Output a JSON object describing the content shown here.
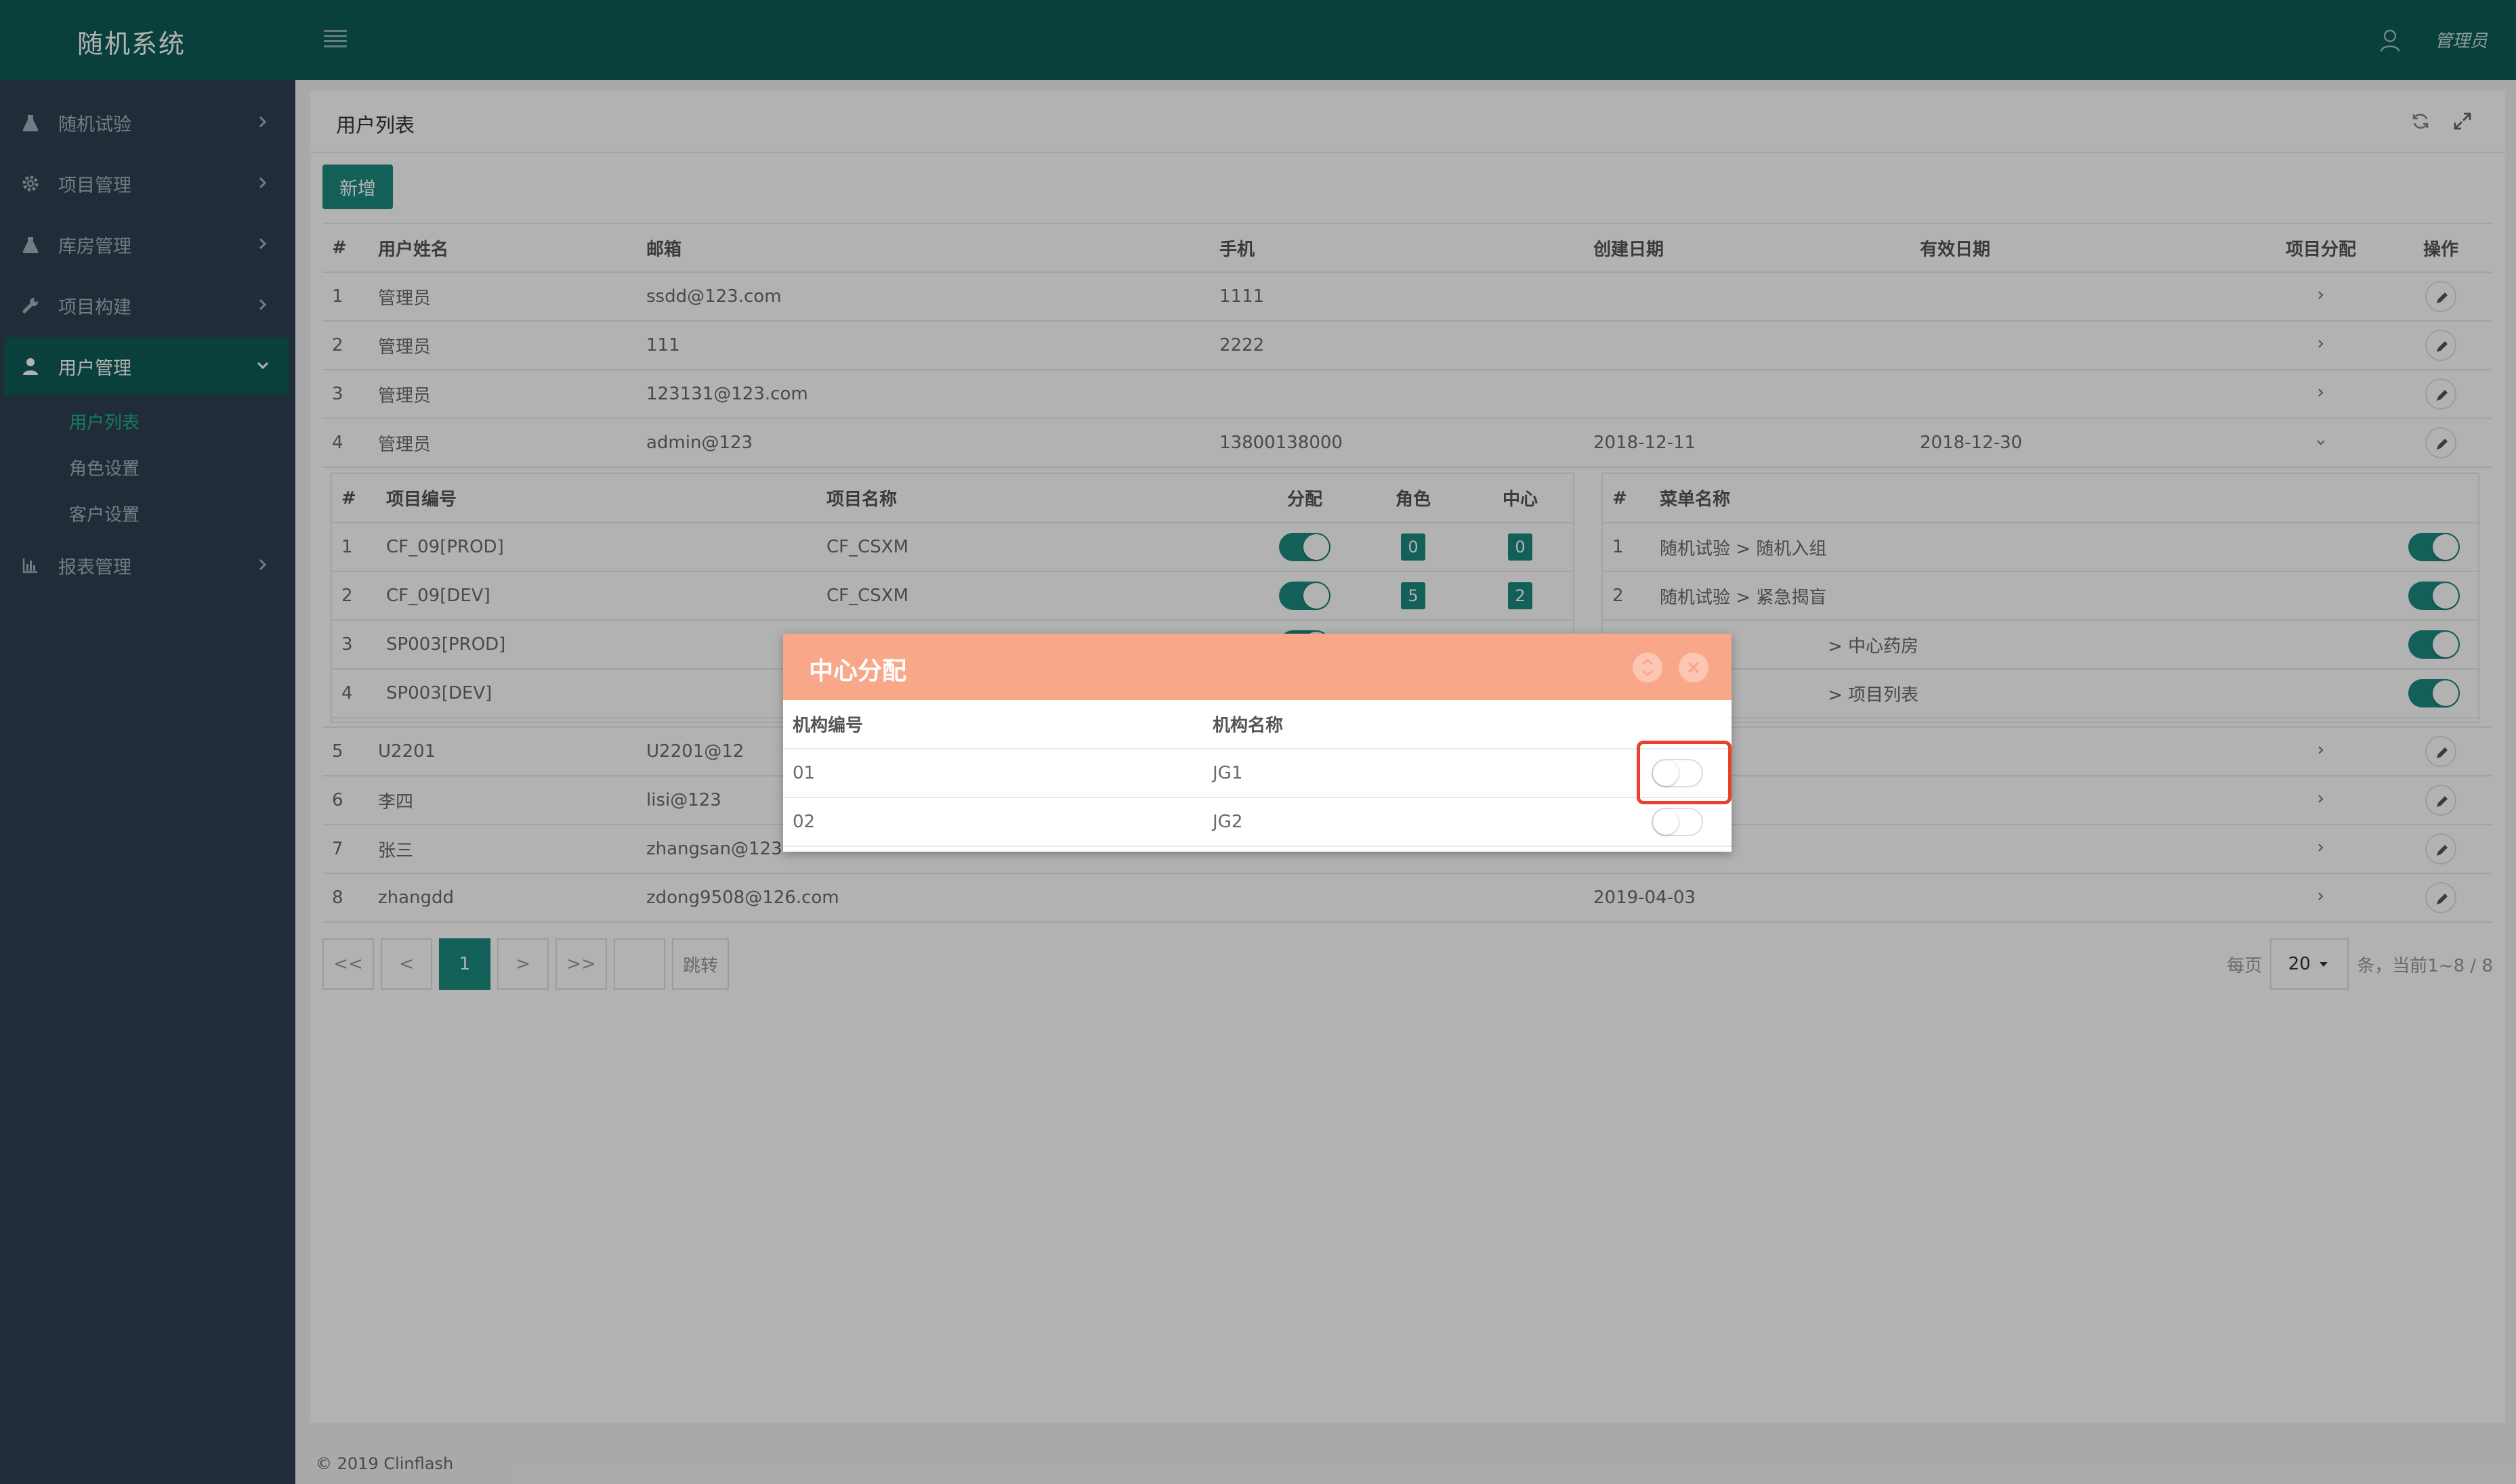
{
  "header": {
    "brand": "随机系统",
    "user_name": "管理员"
  },
  "sidebar": {
    "items": [
      {
        "label": "随机试验",
        "icon": "flask-icon"
      },
      {
        "label": "项目管理",
        "icon": "gear-icon"
      },
      {
        "label": "库房管理",
        "icon": "flask-icon"
      },
      {
        "label": "项目构建",
        "icon": "wrench-icon"
      },
      {
        "label": "用户管理",
        "icon": "user-icon"
      },
      {
        "label": "报表管理",
        "icon": "bar-chart-icon"
      }
    ],
    "sub_items": [
      "用户列表",
      "角色设置",
      "客户设置"
    ]
  },
  "main": {
    "title": "用户列表",
    "new_button": "新增",
    "columns": [
      "#",
      "用户姓名",
      "邮箱",
      "手机",
      "创建日期",
      "有效日期",
      "项目分配",
      "操作"
    ],
    "rows_top": [
      {
        "num": "1",
        "name": "管理员",
        "email": "ssdd@123.com",
        "phone": "1111",
        "created": "",
        "valid": ""
      },
      {
        "num": "2",
        "name": "管理员",
        "email": "111",
        "phone": "2222",
        "created": "",
        "valid": ""
      },
      {
        "num": "3",
        "name": "管理员",
        "email": "123131@123.com",
        "phone": "",
        "created": "",
        "valid": ""
      },
      {
        "num": "4",
        "name": "管理员",
        "email": "admin@123",
        "phone": "13800138000",
        "created": "2018-12-11",
        "valid": "2018-12-30"
      }
    ],
    "rows_bottom": [
      {
        "num": "5",
        "name": "U2201",
        "email": "U2201@12",
        "phone": "",
        "created": "",
        "valid": ""
      },
      {
        "num": "6",
        "name": "李四",
        "email": "lisi@123",
        "phone": "",
        "created": "",
        "valid": ""
      },
      {
        "num": "7",
        "name": "张三",
        "email": "zhangsan@123",
        "phone": "",
        "created": "",
        "valid": ""
      },
      {
        "num": "8",
        "name": "zhangdd",
        "email": "zdong9508@126.com",
        "phone": "",
        "created": "2019-04-03",
        "valid": ""
      }
    ],
    "projects": {
      "columns": [
        "#",
        "项目编号",
        "项目名称",
        "分配",
        "角色",
        "中心"
      ],
      "rows": [
        {
          "num": "1",
          "code": "CF_09[PROD]",
          "name": "CF_CSXM",
          "role": "0",
          "center": "0"
        },
        {
          "num": "2",
          "code": "CF_09[DEV]",
          "name": "CF_CSXM",
          "role": "5",
          "center": "2"
        },
        {
          "num": "3",
          "code": "SP003[PROD]",
          "name": "",
          "role": "",
          "center": ""
        },
        {
          "num": "4",
          "code": "SP003[DEV]",
          "name": "",
          "role": "",
          "center": ""
        }
      ]
    },
    "menus": {
      "columns": [
        "#",
        "菜单名称"
      ],
      "rows": [
        {
          "num": "1",
          "name": "随机试验 > 随机入组"
        },
        {
          "num": "2",
          "name": "随机试验 > 紧急揭盲"
        },
        {
          "num": "3",
          "name": "> 中心药房"
        },
        {
          "num": "4",
          "name": "> 项目列表"
        }
      ]
    },
    "pager": {
      "first": "<<",
      "prev": "<",
      "current": "1",
      "next": ">",
      "last": ">>",
      "jump": "跳转",
      "per_page_label": "每页",
      "per_page_value": "20",
      "summary": "条，当前1~8 / 8"
    }
  },
  "dialog": {
    "title": "中心分配",
    "columns": [
      "机构编号",
      "机构名称"
    ],
    "rows": [
      {
        "code": "01",
        "name": "JG1"
      },
      {
        "code": "02",
        "name": "JG2"
      }
    ]
  },
  "footer": "© 2019 Clinflash",
  "colors": {
    "brand": "#0e5c56",
    "accent": "#1a8a7f",
    "dialog_header": "#f8a889",
    "highlight": "#e8412e"
  }
}
